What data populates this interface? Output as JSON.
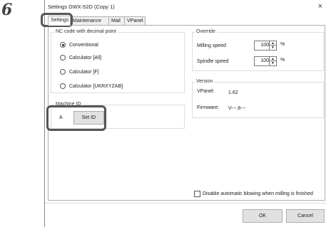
{
  "step_number": "6",
  "window": {
    "title": "Settings DWX-52D (Copy 1)",
    "close_label": "×"
  },
  "tabs": [
    {
      "label": "Settings",
      "active": true
    },
    {
      "label": "Maintenance",
      "active": false
    },
    {
      "label": "Mail",
      "active": false
    },
    {
      "label": "VPanel",
      "active": false
    }
  ],
  "nc_code": {
    "legend": "NC code with decimal point",
    "options": [
      {
        "label": "Conventional",
        "selected": true
      },
      {
        "label": "Calculator [All]",
        "selected": false
      },
      {
        "label": "Calculator [F]",
        "selected": false
      },
      {
        "label": "Calculator [UKRXYZAB]",
        "selected": false
      }
    ]
  },
  "override": {
    "legend": "Override",
    "milling_label": "Milling speed",
    "milling_value": "100",
    "spindle_label": "Spindle speed",
    "spindle_value": "100",
    "unit": "%"
  },
  "version": {
    "legend": "Version",
    "vpanel_label": "VPanel:",
    "vpanel_value": "1.62",
    "firmware_label": "Firmware:",
    "firmware_value": "V---.8---"
  },
  "machine_id": {
    "legend": "Machine ID",
    "value": "A",
    "set_id_label": "Set ID"
  },
  "disable_blowing": {
    "label": "Disable automatic blowing when milling is finished",
    "checked": false
  },
  "buttons": {
    "ok": "OK",
    "cancel": "Cancel"
  },
  "colors": {
    "highlight": "#555555",
    "window_border": "#8a8a8a"
  }
}
